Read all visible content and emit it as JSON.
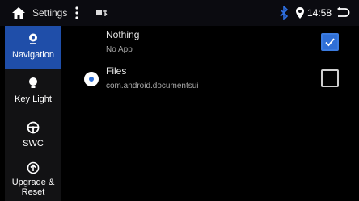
{
  "statusbar": {
    "title": "Settings",
    "time": "14:58"
  },
  "sidebar": {
    "items": [
      {
        "label": "Navigation",
        "icon": "location-icon",
        "active": true
      },
      {
        "label": "Key Light",
        "icon": "bulb-icon",
        "active": false
      },
      {
        "label": "SWC",
        "icon": "steering-wheel-icon",
        "active": false
      },
      {
        "label": "Upgrade & Reset",
        "icon": "upgrade-icon",
        "active": false
      }
    ]
  },
  "apps": [
    {
      "name": "Nothing",
      "package": "No App",
      "checked": true,
      "selected": false
    },
    {
      "name": "Files",
      "package": "com.android.documentsui",
      "checked": false,
      "selected": true
    }
  ],
  "colors": {
    "accent": "#1f4ea9",
    "checkbox": "#2f6fd6",
    "background": "#000000"
  }
}
